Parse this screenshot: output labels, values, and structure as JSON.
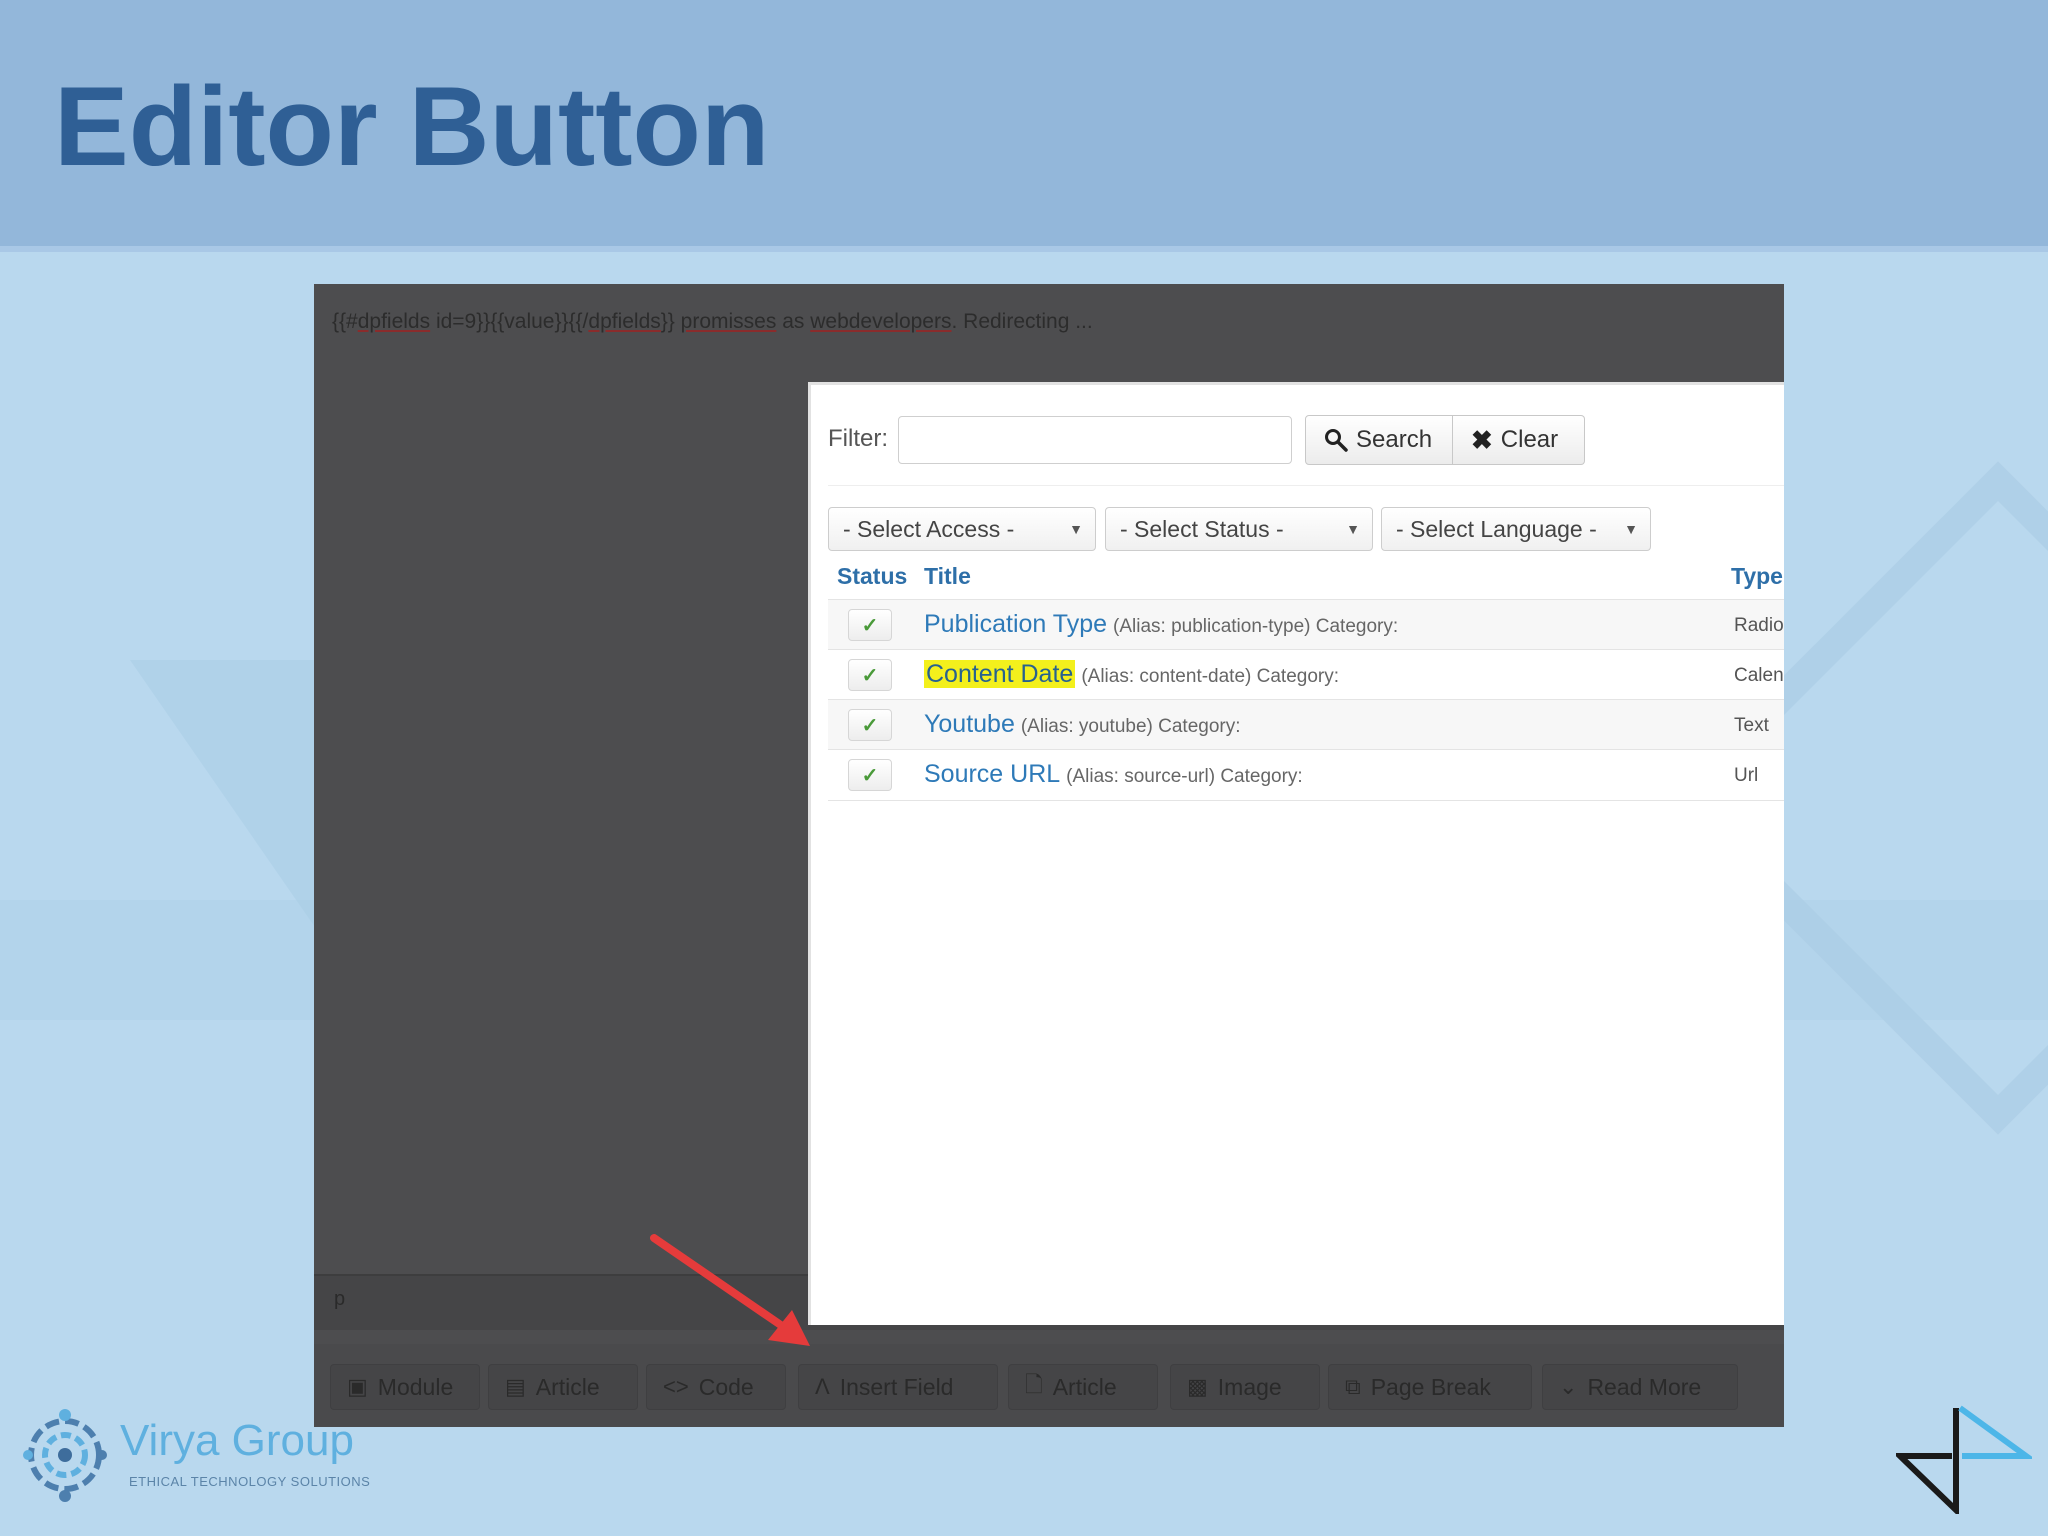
{
  "slide": {
    "title": "Editor Button"
  },
  "editor": {
    "content_parts": [
      "{{#",
      "dpfields",
      " id=9}}{{value}}{{/",
      "dpfields",
      "}} ",
      "promisses",
      " as ",
      "webdevelopers",
      ". Redirecting ..."
    ],
    "path": "p"
  },
  "modal": {
    "filter_label": "Filter:",
    "filter_value": "",
    "search_label": "Search",
    "clear_label": "Clear",
    "selects": [
      {
        "label": "- Select Access -"
      },
      {
        "label": "- Select Status -"
      },
      {
        "label": "- Select Language -"
      }
    ],
    "columns": {
      "status": "Status",
      "title": "Title",
      "type": "Type"
    },
    "rows": [
      {
        "title": "Publication Type",
        "meta": "(Alias: publication-type) Category:",
        "type": "Radio",
        "highlighted": false
      },
      {
        "title": "Content Date",
        "meta": "(Alias: content-date) Category:",
        "type": "Calend",
        "highlighted": true
      },
      {
        "title": "Youtube",
        "meta": "(Alias: youtube) Category:",
        "type": "Text",
        "highlighted": false
      },
      {
        "title": "Source URL",
        "meta": "(Alias: source-url) Category:",
        "type": "Url",
        "highlighted": false
      }
    ]
  },
  "toolbar": {
    "buttons": [
      {
        "label": "Module",
        "icon": "module-icon"
      },
      {
        "label": "Article",
        "icon": "article-icon"
      },
      {
        "label": "Code",
        "icon": "code-icon"
      },
      {
        "label": "Insert Field",
        "icon": "insert-field-icon"
      },
      {
        "label": "Article",
        "icon": "file-icon"
      },
      {
        "label": "Image",
        "icon": "image-icon"
      },
      {
        "label": "Page Break",
        "icon": "page-break-icon"
      },
      {
        "label": "Read More",
        "icon": "chevron-down-icon"
      }
    ]
  },
  "branding": {
    "company": "Virya Group",
    "tagline": "ETHICAL TECHNOLOGY SOLUTIONS",
    "accent_color": "#5fb0df",
    "title_color": "#2f5f95",
    "highlight_color": "#f3f01c",
    "arrow_color": "#e53b3b"
  }
}
